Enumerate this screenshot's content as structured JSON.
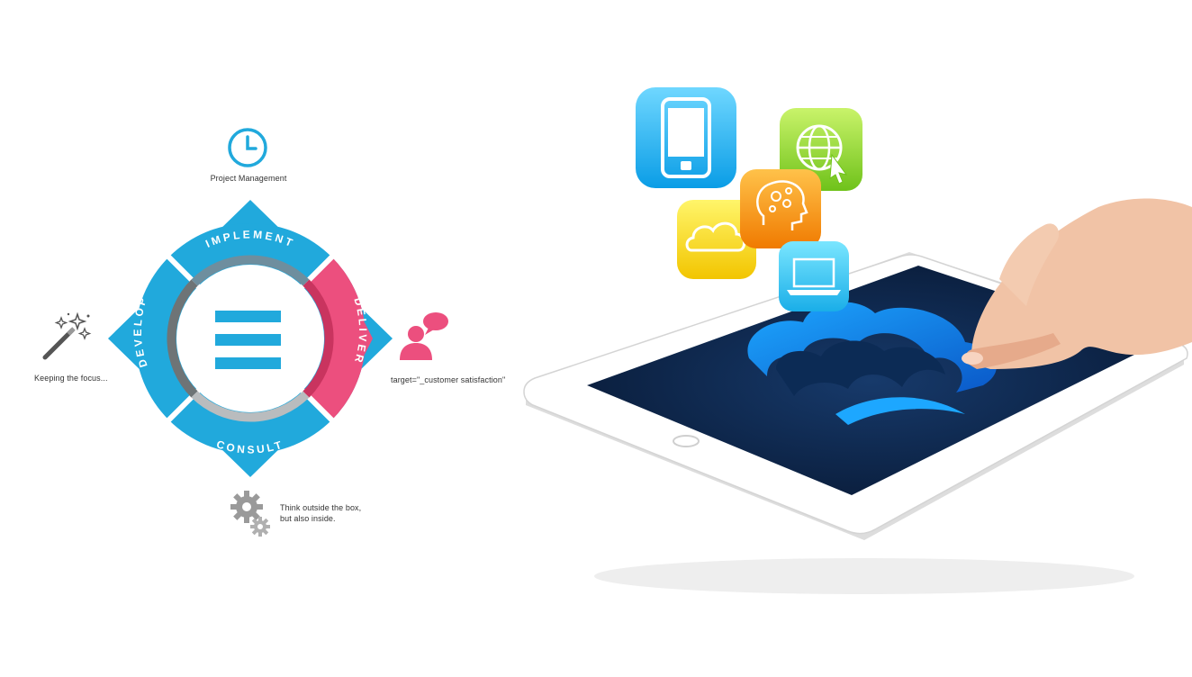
{
  "colors": {
    "blue": "#21a9dc",
    "pink": "#ec4f7e",
    "gray_inner": "#b9bcbe",
    "dark_gray_inner": "#6e7476",
    "text": "#333333",
    "tablet_screen": "#0b1f3f"
  },
  "diagram": {
    "top_label": "Project Management",
    "left_label": "Keeping the focus...",
    "right_label": "target=\"_customer satisfaction\"",
    "bottom_label_line1": "Think outside the box,",
    "bottom_label_line2": "but also inside.",
    "segments": {
      "top": "IMPLEMENT",
      "right": "DELIVER",
      "bottom": "CONSULT",
      "left": "DEVELOP"
    },
    "icons": {
      "top": "clock-icon",
      "left": "magic-wand-icon",
      "right": "speaking-person-icon",
      "bottom": "gears-icon",
      "center": "menu-lines-icon"
    }
  },
  "illustration": {
    "app_icons": [
      "smartphone-icon",
      "globe-cursor-icon",
      "brain-gears-icon",
      "cloud-icon",
      "laptop-icon"
    ],
    "screen_graphic": "cloud-logo",
    "hand": "hand-touching-screen"
  }
}
